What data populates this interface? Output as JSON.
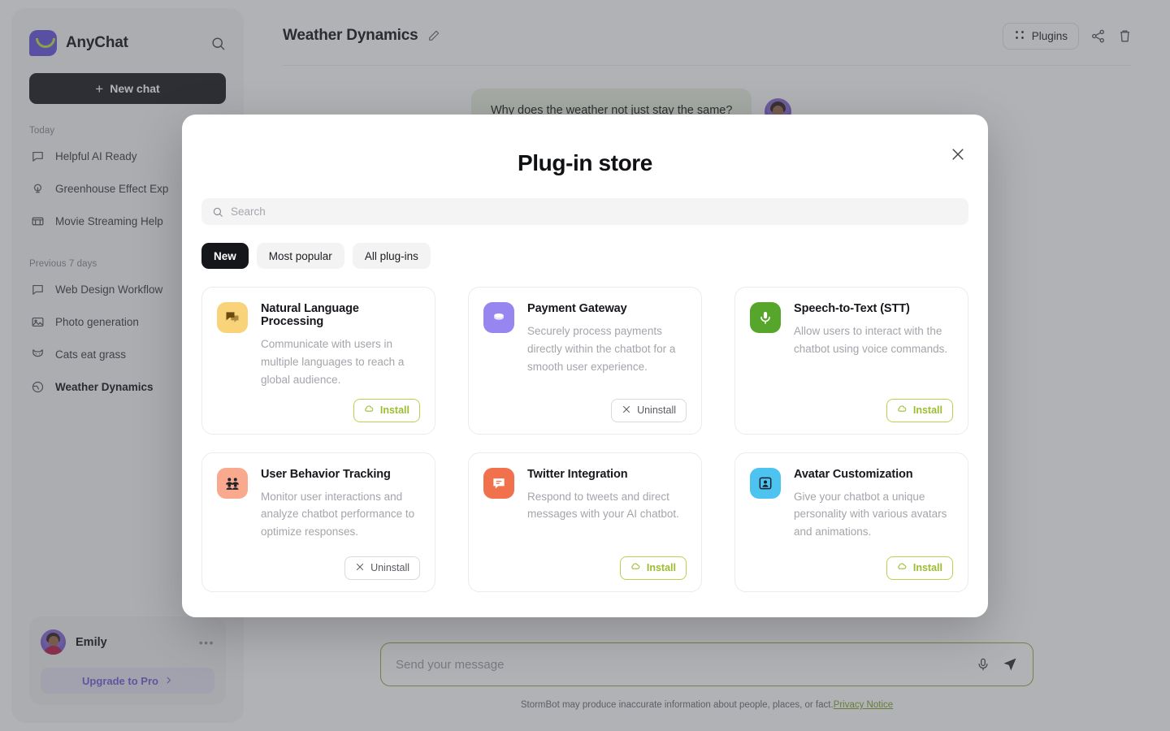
{
  "sidebar": {
    "brand": "AnyChat",
    "search_icon": "search-icon",
    "new_chat_label": "New chat",
    "groups": [
      {
        "label": "Today",
        "items": [
          {
            "label": "Helpful AI Ready",
            "icon": "chat-bubble-icon",
            "active": false
          },
          {
            "label": "Greenhouse Effect Exp",
            "icon": "lightbulb-icon",
            "active": false
          },
          {
            "label": "Movie Streaming Help",
            "icon": "film-icon",
            "active": false
          }
        ]
      },
      {
        "label": "Previous 7 days",
        "items": [
          {
            "label": "Web Design Workflow",
            "icon": "chat-bubble-icon",
            "active": false
          },
          {
            "label": "Photo generation",
            "icon": "image-icon",
            "active": false
          },
          {
            "label": "Cats eat grass",
            "icon": "cat-icon",
            "active": false
          },
          {
            "label": "Weather Dynamics",
            "icon": "globe-icon",
            "active": true
          }
        ]
      }
    ],
    "user": {
      "name": "Emily",
      "more_icon": "ellipsis-icon",
      "upgrade_label": "Upgrade to Pro",
      "upgrade_chevron": "chevron-right-icon"
    }
  },
  "header": {
    "title": "Weather Dynamics",
    "edit_icon": "pencil-icon",
    "plugins_label": "Plugins",
    "plugins_icon": "grid-dots-icon",
    "share_icon": "share-icon",
    "delete_icon": "trash-icon"
  },
  "conversation": {
    "messages": [
      {
        "role": "user",
        "text": "Why does the weather not just stay the same?"
      }
    ]
  },
  "composer": {
    "placeholder": "Send your message",
    "value": "",
    "mic_icon": "microphone-icon",
    "send_icon": "send-icon"
  },
  "footer": {
    "disclaimer": "StormBot may produce inaccurate information about people, places, or fact.",
    "link_label": "Privacy Notice"
  },
  "modal": {
    "title": "Plug-in store",
    "close_icon": "close-icon",
    "search": {
      "placeholder": "Search",
      "value": "",
      "icon": "search-icon"
    },
    "filters": [
      {
        "label": "New",
        "selected": true
      },
      {
        "label": "Most popular",
        "selected": false
      },
      {
        "label": "All plug-ins",
        "selected": false
      }
    ],
    "plugins": [
      {
        "title": "Natural Language Processing",
        "description": "Communicate with users in multiple languages to reach a global audience.",
        "icon": "chat-bubbles-icon",
        "icon_bg": "#f8d37a",
        "icon_fg": "#6b4a10",
        "action": "Install",
        "action_icon": "cloud-download-icon",
        "action_type": "install"
      },
      {
        "title": "Payment Gateway",
        "description": "Securely process payments directly within the chatbot for a smooth user experience.",
        "icon": "coins-icon",
        "icon_bg": "#9785f0",
        "icon_fg": "#ffffff",
        "action": "Uninstall",
        "action_icon": "close-icon",
        "action_type": "uninstall"
      },
      {
        "title": "Speech-to-Text (STT)",
        "description": "Allow users to interact with the chatbot using voice commands.",
        "icon": "microphone-icon",
        "icon_bg": "#55a62b",
        "icon_fg": "#ffffff",
        "action": "Install",
        "action_icon": "cloud-download-icon",
        "action_type": "install"
      },
      {
        "title": "User Behavior Tracking",
        "description": "Monitor user interactions and analyze chatbot performance to optimize responses.",
        "icon": "people-group-icon",
        "icon_bg": "#f8a98e",
        "icon_fg": "#20212a",
        "action": "Uninstall",
        "action_icon": "close-icon",
        "action_type": "uninstall"
      },
      {
        "title": "Twitter Integration",
        "description": "Respond to tweets and direct messages with your AI chatbot.",
        "icon": "message-square-icon",
        "icon_bg": "#f1714c",
        "icon_fg": "#ffffff",
        "action": "Install",
        "action_icon": "cloud-download-icon",
        "action_type": "install"
      },
      {
        "title": "Avatar Customization",
        "description": "Give your chatbot a unique personality with various avatars and animations.",
        "icon": "portrait-icon",
        "icon_bg": "#4dc3f0",
        "icon_fg": "#14202a",
        "action": "Install",
        "action_icon": "cloud-download-icon",
        "action_type": "install"
      }
    ]
  },
  "colors": {
    "accent_purple": "#6a57e0",
    "accent_green": "#9cbd2e",
    "dark": "#15161a",
    "bubble_green": "#eaf3e2"
  }
}
